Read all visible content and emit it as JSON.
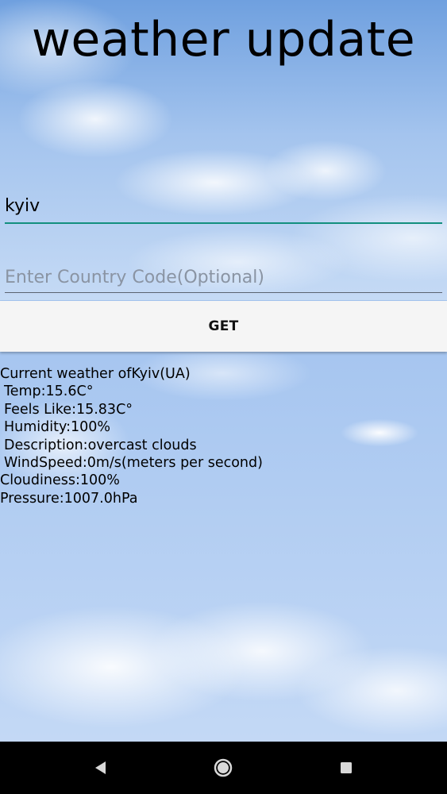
{
  "app": {
    "title": "weather update"
  },
  "form": {
    "city_value": "kyiv",
    "country_placeholder": "Enter Country Code(Optional)",
    "country_value": "",
    "get_label": "GET"
  },
  "weather": {
    "header": "Current weather ofKyiv(UA)",
    "temp": "Temp:15.6C°",
    "feels_like": "Feels Like:15.83C°",
    "humidity": "Humidity:100%",
    "description": "Description:overcast clouds",
    "wind_speed": "WindSpeed:0m/s(meters per second)",
    "cloudiness": "Cloudiness:100%",
    "pressure": "Pressure:1007.0hPa"
  },
  "navbar": {
    "back_icon": "triangle-back-icon",
    "home_icon": "circle-home-icon",
    "recents_icon": "square-recents-icon"
  },
  "colors": {
    "input_underline_active": "#128f7e",
    "button_background": "#f5f5f5",
    "navbar_background": "#000000"
  }
}
